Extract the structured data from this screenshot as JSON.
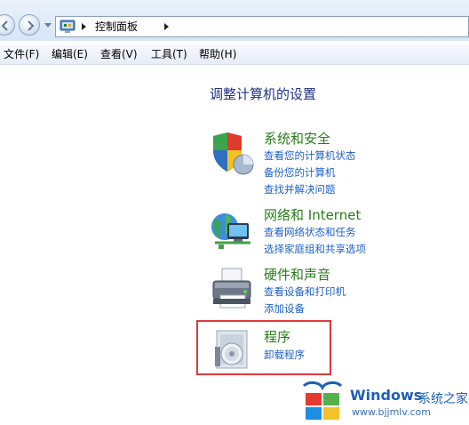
{
  "address_bar": {
    "breadcrumb": "控制面板"
  },
  "menu": [
    {
      "label": "文件(F)"
    },
    {
      "label": "编辑(E)"
    },
    {
      "label": "查看(V)"
    },
    {
      "label": "工具(T)"
    },
    {
      "label": "帮助(H)"
    }
  ],
  "page_title": "调整计算机的设置",
  "categories": [
    {
      "title": "系统和安全",
      "icon": "shield-icon",
      "links": [
        "查看您的计算机状态",
        "备份您的计算机",
        "查找并解决问题"
      ]
    },
    {
      "title": "网络和 Internet",
      "icon": "network-globe-icon",
      "links": [
        "查看网络状态和任务",
        "选择家庭组和共享选项"
      ]
    },
    {
      "title": "硬件和声音",
      "icon": "printer-icon",
      "links": [
        "查看设备和打印机",
        "添加设备"
      ]
    },
    {
      "title": "程序",
      "icon": "programs-disc-icon",
      "links": [
        "卸载程序"
      ]
    }
  ],
  "watermark": {
    "title": "Windows",
    "subtitle": "系统之家",
    "url": "www.bjjmlv.com"
  },
  "colors": {
    "category_title": "#2a7d1b",
    "link": "#1e62c8",
    "highlight_border": "#e0393e",
    "page_title": "#1e3287"
  }
}
